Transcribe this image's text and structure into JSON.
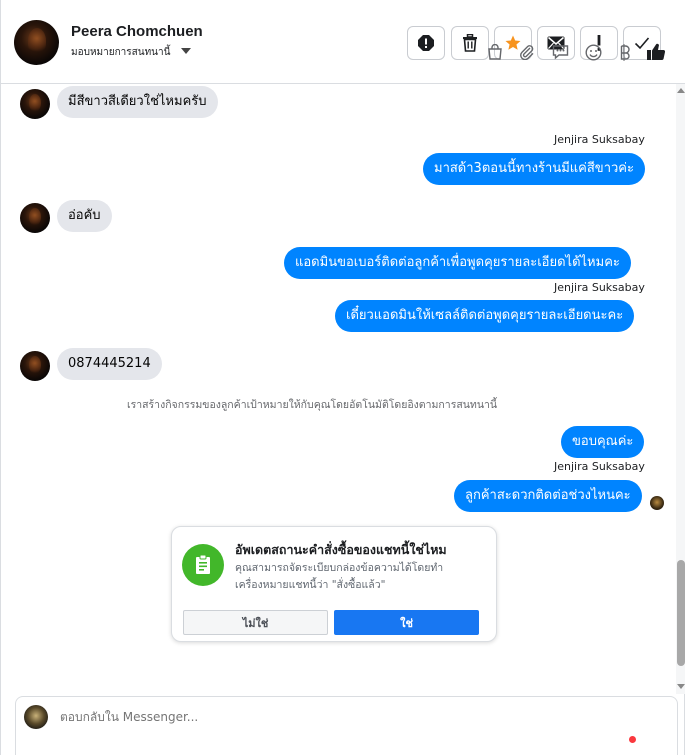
{
  "header": {
    "name": "Peera Chomchuen",
    "assign_label": "มอบหมายการสนทนานี้",
    "tools": [
      {
        "icon": "spam-icon"
      },
      {
        "icon": "trash-icon"
      },
      {
        "icon": "star-icon",
        "color": "#f7931e"
      },
      {
        "icon": "mail-icon"
      },
      {
        "icon": "exclamation-icon"
      },
      {
        "icon": "check-icon"
      }
    ]
  },
  "messages": {
    "m1": "มีสีขาวสีเดียวใช่ไหมครับ",
    "sender1": "Jenjira Suksabay",
    "m2": "มาสด้า3ตอนนี้ทางร้านมีแค่สีขาวค่ะ",
    "m3": "อ่อคับ",
    "m4": "แอดมินขอเบอร์ติดต่อลูกค้าเพื่อพูดคุยรายละเอียดได้ไหมคะ",
    "sender2": "Jenjira Suksabay",
    "m5": "เดี๋ยวแอดมินให้เซลล์ติดต่อพูดคุยรายละเอียดนะคะ",
    "m6": "0874445214",
    "system": "เราสร้างกิจกรรมของลูกค้าเป้าหมายให้กับคุณโดยอัตโนมัติโดยอิงตามการสนทนานี้",
    "m7": "ขอบคุณค่ะ",
    "sender3": "Jenjira Suksabay",
    "m8": "ลูกค้าสะดวกติดต่อช่วงไหนคะ"
  },
  "card": {
    "title": "อัพเดตสถานะคำสั่งซื้อของแชทนี้ใช่ไหม",
    "body": "คุณสามารถจัดระเบียบกล่องข้อความได้โดยทำเครื่องหมายแชทนี้ว่า \"สั่งซื้อแล้ว\"",
    "no_label": "ไม่ใช่",
    "yes_label": "ใช่"
  },
  "composer": {
    "placeholder": "ตอบกลับใน Messenger...",
    "icons": [
      "bag-icon",
      "paperclip-icon",
      "saved-reply-icon",
      "emoji-icon",
      "payment-icon",
      "like-icon"
    ]
  },
  "colors": {
    "accent": "#0084ff",
    "incoming_bubble": "#e4e6eb",
    "card_icon": "#42b72a",
    "primary_button": "#1877f2"
  }
}
